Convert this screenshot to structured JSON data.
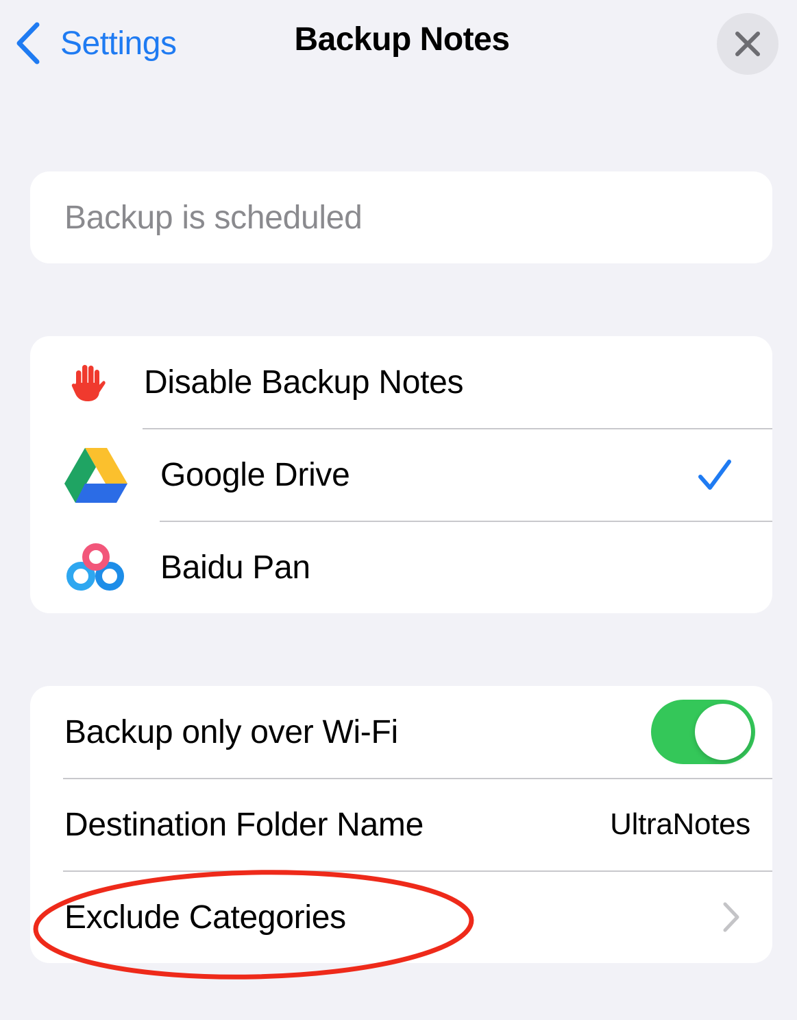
{
  "nav": {
    "back_label": "Settings",
    "title": "Backup Notes"
  },
  "status": {
    "text": "Backup is scheduled"
  },
  "providers": {
    "items": [
      {
        "label": "Disable Backup Notes",
        "icon": "raised-hand-icon",
        "selected": false
      },
      {
        "label": "Google Drive",
        "icon": "google-drive-icon",
        "selected": true
      },
      {
        "label": "Baidu Pan",
        "icon": "baidu-pan-icon",
        "selected": false
      }
    ]
  },
  "settings": {
    "wifi_only_label": "Backup only over Wi-Fi",
    "wifi_only_enabled": true,
    "destination_label": "Destination Folder Name",
    "destination_value": "UltraNotes",
    "exclude_label": "Exclude Categories"
  },
  "colors": {
    "accent": "#1f7bf2",
    "toggle_on": "#34c759",
    "background": "#f2f2f7",
    "annotation": "#ee2a1a"
  }
}
